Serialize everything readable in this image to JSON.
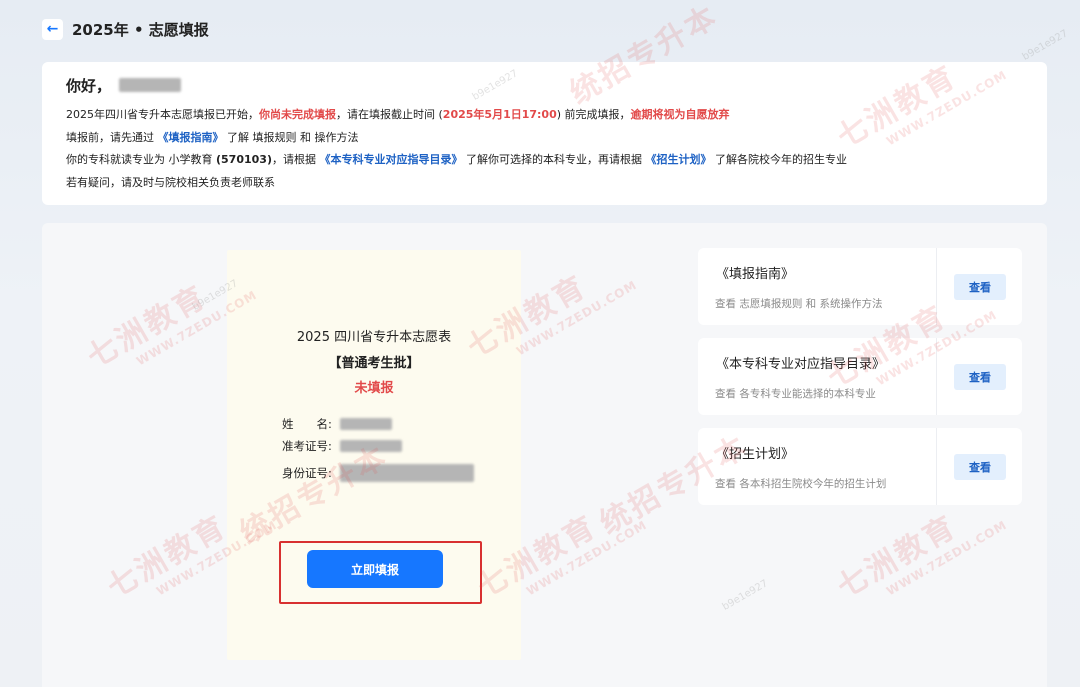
{
  "header": {
    "back_icon": "arrow-left-icon",
    "title": "2025年 • 志愿填报"
  },
  "notice": {
    "greeting": "你好，",
    "line1": {
      "t1": "2025年四川省专升本志愿填报已开始，",
      "t2": "你尚未完成填报",
      "t3": "，请在填报截止时间 (",
      "t4": "2025年5月1日17:00",
      "t5": ") 前完成填报，",
      "t6": "逾期将视为自愿放弃"
    },
    "line2": {
      "t1": "填报前，请先通过 ",
      "t2": "《填报指南》",
      "t3": " 了解 填报规则 和 操作方法"
    },
    "line3": {
      "t1": "你的专科就读专业为 小学教育 ",
      "t2": "(570103)",
      "t3": "，请根据 ",
      "t4": "《本专科专业对应指导目录》",
      "t5": " 了解你可选择的本科专业，再请根据 ",
      "t6": "《招生计划》",
      "t7": " 了解各院校今年的招生专业"
    },
    "line4": "若有疑问，请及时与院校相关负责老师联系"
  },
  "form": {
    "title": "2025 四川省专升本志愿表",
    "batch": "【普通考生批】",
    "status": "未填报",
    "fields": {
      "name_label": "姓　　名:",
      "exam_label": "准考证号:",
      "id_label": "身份证号:"
    },
    "submit_label": "立即填报"
  },
  "references": [
    {
      "title": "《填报指南》",
      "desc": "查看 志愿填报规则 和 系统操作方法",
      "button": "查看"
    },
    {
      "title": "《本专科专业对应指导目录》",
      "desc": "查看 各专科专业能选择的本科专业",
      "button": "查看"
    },
    {
      "title": "《招生计划》",
      "desc": "查看 各本科招生院校今年的招生计划",
      "button": "查看"
    }
  ],
  "watermark": {
    "brand": "七洲教育",
    "sub": "统招专升本",
    "url": "WWW.7ZEDU.COM",
    "code": "b9e1e927"
  },
  "colors": {
    "accent": "#1677ff",
    "warning_red": "#e24a4a",
    "link_blue": "#1e62c4",
    "form_bg": "#fdfbef"
  }
}
